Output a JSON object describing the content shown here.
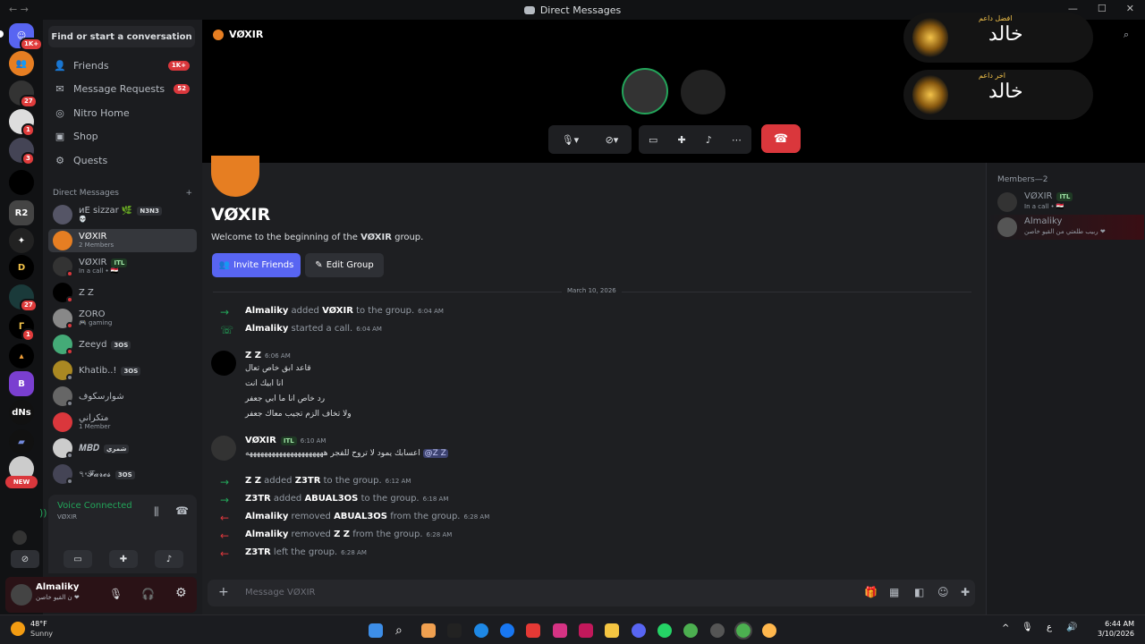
{
  "window": {
    "title": "Direct Messages"
  },
  "rail": {
    "badges": [
      "1K+",
      "27",
      "1",
      "3",
      "27",
      "1"
    ],
    "new_label": "NEW",
    "dns_label": "dNs"
  },
  "sidebar": {
    "find_placeholder": "Find or start a conversation",
    "nav": [
      {
        "label": "Friends",
        "count": "1K+",
        "icon": "friends-icon"
      },
      {
        "label": "Message Requests",
        "count": "52",
        "icon": "mail-icon"
      },
      {
        "label": "Nitro Home",
        "icon": "nitro-icon"
      },
      {
        "label": "Shop",
        "icon": "shop-icon"
      },
      {
        "label": "Quests",
        "icon": "quests-icon"
      }
    ],
    "dm_header": "Direct Messages",
    "dm_add": "+",
    "dms": [
      {
        "name": "иЕ sizzar 🌿",
        "tag": "N3N3",
        "sub": "💀"
      },
      {
        "name": "VØXIR",
        "sub": "2 Members"
      },
      {
        "name": "VØXIR",
        "tag": "ITL",
        "sub": "In a call • 🇪🇬"
      },
      {
        "name": "Z Z",
        "sub": ""
      },
      {
        "name": "ZORO",
        "sub": "🎮 gaming"
      },
      {
        "name": "Zeeyd",
        "tag": "3OS",
        "sub": ""
      },
      {
        "name": "Khatib..!",
        "tag": "3OS",
        "sub": ""
      },
      {
        "name": "شوارسكوف",
        "sub": ""
      },
      {
        "name": "متكراني",
        "sub": "1 Member"
      },
      {
        "name": "𝑴𝑩𝑫",
        "tag": "شمري",
        "sub": ""
      },
      {
        "name": "৭৽𝓕𝓪𝓻𝓮𝓼",
        "tag": "3OS",
        "sub": ""
      }
    ]
  },
  "voice": {
    "title": "Voice Connected",
    "channel": "VØXIR"
  },
  "user": {
    "name": "Almaliky",
    "status": "ن القيو خاصن ❤"
  },
  "call": {
    "channel_name": "VØXIR"
  },
  "chat": {
    "group_title": "VØXIR",
    "welcome_prefix": "Welcome to the beginning of the ",
    "welcome_group": "VØXIR",
    "welcome_suffix": " group.",
    "invite_label": "Invite Friends",
    "edit_label": "Edit Group",
    "date_divider": "March 10, 2026",
    "placeholder": "Message VØXIR",
    "events": [
      {
        "actor": "Almaliky",
        "verb": "added",
        "target": "VØXIR",
        "tail": "to the group.",
        "time": "6:04 AM"
      },
      {
        "actor": "Almaliky",
        "verb": "started a call.",
        "target": "",
        "tail": "",
        "time": "6:04 AM"
      }
    ],
    "msg1": {
      "author": "Z Z",
      "time": "6:06 AM",
      "lines": [
        "قاعد ابق خاص تعال",
        "انا ابيك انت",
        "رد خاص انا ما ابي جعفر",
        "ولا تخاف الزم تجيب معاك جعفر"
      ]
    },
    "msg2": {
      "author": "VØXIR",
      "tag": "ITL",
      "time": "6:10 AM",
      "mention": "@Z Z",
      "text": "اعسابك يمود لا تروح للفجر هههههههههههههههههههههه"
    },
    "events2": [
      {
        "actor": "Z Z",
        "verb": "added",
        "target": "Z3TR",
        "tail": "to the group.",
        "time": "6:12 AM"
      },
      {
        "actor": "Z3TR",
        "verb": "added",
        "target": "ABUAL3OS",
        "tail": "to the group.",
        "time": "6:18 AM"
      },
      {
        "actor": "Almaliky",
        "verb": "removed",
        "target": "ABUAL3OS",
        "tail": "from the group.",
        "time": "6:28 AM"
      },
      {
        "actor": "Almaliky",
        "verb": "removed",
        "target": "Z Z",
        "tail": "from the group.",
        "time": "6:28 AM"
      },
      {
        "actor": "Z3TR",
        "verb": "left the group.",
        "target": "",
        "tail": "",
        "time": "6:28 AM"
      }
    ]
  },
  "members": {
    "header": "Members—2",
    "list": [
      {
        "name": "VØXIR",
        "tag": "ITL",
        "sub": "In a call • 🇪🇬"
      },
      {
        "name": "Almaliky",
        "sub": "ربيب طلعتي من القيو خاصن ❤"
      }
    ]
  },
  "banner": {
    "top_small": "افضل داعم",
    "bottom_small": "اخر داعم",
    "name": "خالد"
  },
  "taskbar": {
    "weather_temp": "48°F",
    "weather_desc": "Sunny",
    "time": "6:44 AM",
    "date": "3/10/2026",
    "lang": "ع"
  },
  "colors": {
    "accent": "#5865f2",
    "danger": "#da373c",
    "online": "#23a55a",
    "group": "#e67e22"
  }
}
